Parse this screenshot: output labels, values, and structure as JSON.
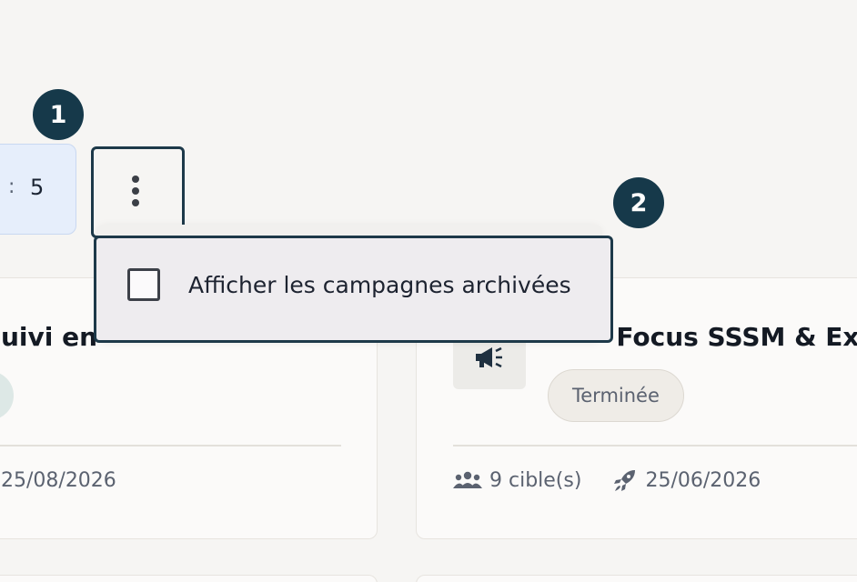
{
  "filter": {
    "separator": ":",
    "value": "5"
  },
  "steps": {
    "first": "1",
    "second": "2"
  },
  "menu": {
    "icon": "more-vertical-icon",
    "items": [
      {
        "label": "Afficher les campagnes archivées",
        "checked": false
      }
    ]
  },
  "cards": {
    "left": {
      "title_fragment": "uivi en",
      "date": "25/08/2026"
    },
    "right": {
      "icon": "megaphone-icon",
      "title_fragment": "- Focus SSSM & Exi",
      "status": "Terminée",
      "targets": "9 cible(s)",
      "targets_icon": "users-icon",
      "launch_icon": "rocket-icon",
      "date": "25/06/2026"
    }
  },
  "colors": {
    "accent": "#16394a",
    "background": "#f6f5f3",
    "chip": "#e6eefb"
  }
}
